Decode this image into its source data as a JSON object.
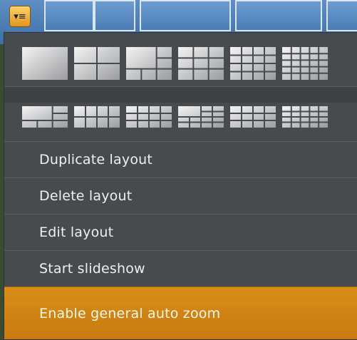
{
  "background": {
    "left_edge_color": "#3b4b2f",
    "strip_color": "#4b7db5"
  },
  "menu_toggle": {
    "icon": "menu-list-icon",
    "glyph": "▾≡",
    "color": "#e0951c"
  },
  "layout_grids": {
    "row1": [
      {
        "name": "1x1",
        "cols": 1,
        "rows": 1
      },
      {
        "name": "2x2",
        "cols": 2,
        "rows": 2
      },
      {
        "name": "1+5",
        "cols": 3,
        "rows": 3,
        "big": 2
      },
      {
        "name": "3x3",
        "cols": 3,
        "rows": 3
      },
      {
        "name": "4x4",
        "cols": 4,
        "rows": 4
      },
      {
        "name": "5x5",
        "cols": 5,
        "rows": 5
      }
    ],
    "row2": [
      {
        "name": "1+3-wide",
        "cols": 3,
        "rows": 3,
        "big": 2
      },
      {
        "name": "4x2-wide",
        "cols": 4,
        "rows": 2
      },
      {
        "name": "mixed-wide",
        "cols": 4,
        "rows": 3
      },
      {
        "name": "1+8-wide",
        "cols": 4,
        "rows": 4,
        "big": 2
      },
      {
        "name": "4x3-wide",
        "cols": 4,
        "rows": 3
      },
      {
        "name": "5x4-wide",
        "cols": 5,
        "rows": 4
      }
    ]
  },
  "menu_items": [
    {
      "label": "Duplicate layout"
    },
    {
      "label": "Delete layout"
    },
    {
      "label": "Edit layout"
    },
    {
      "label": "Start slideshow"
    },
    {
      "label": "Enable general auto zoom"
    }
  ],
  "colors": {
    "menu_bg": "#474a4f",
    "highlight": "#d98e18"
  }
}
